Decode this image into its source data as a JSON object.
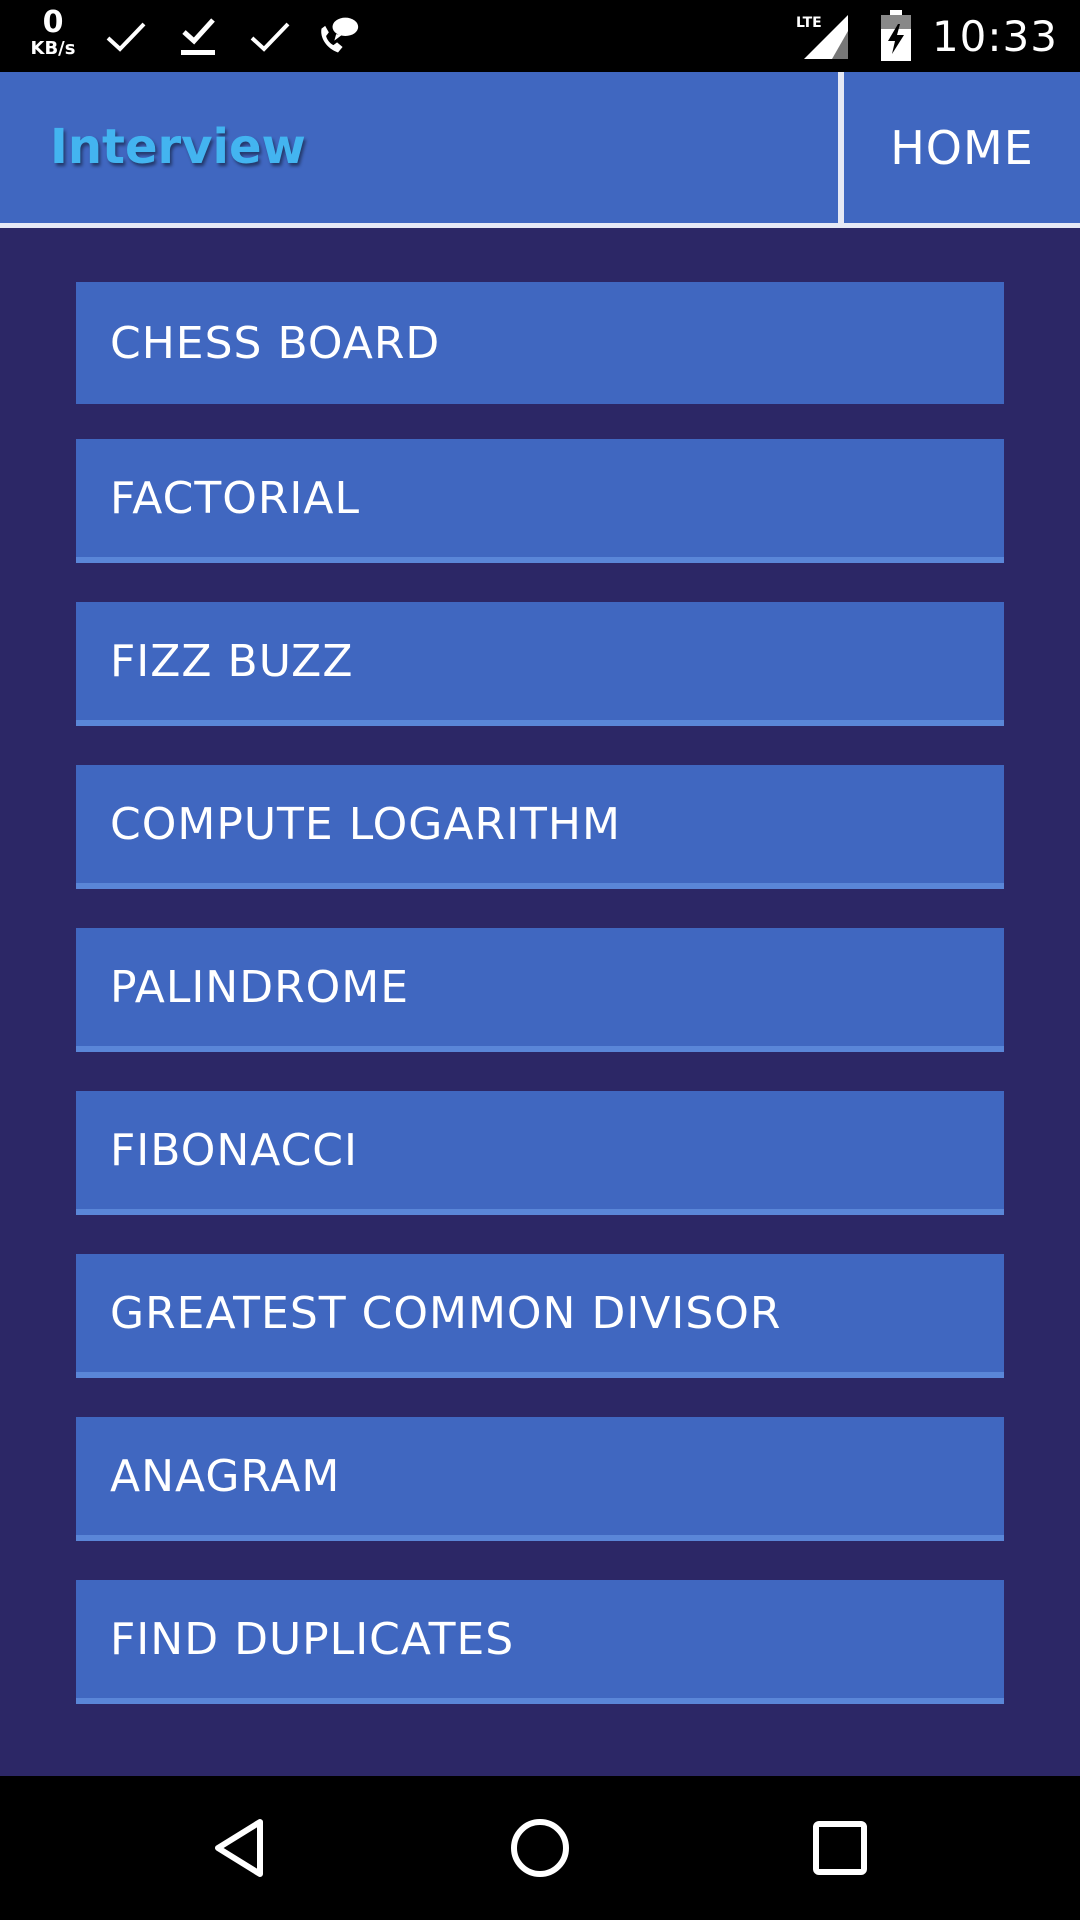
{
  "status_bar": {
    "net_speed_value": "0",
    "net_speed_unit": "KB/s",
    "network": "LTE",
    "clock": "10:33",
    "icons": [
      "check-icon",
      "download-done-icon",
      "check-icon",
      "missed-call-icon",
      "lte-signal-icon",
      "battery-charging-icon"
    ]
  },
  "app_bar": {
    "title": "Interview",
    "home_label": "HOME",
    "title_color": "#43b4f0",
    "bar_color": "#4067c0"
  },
  "menu": {
    "items": [
      {
        "label": "CHESS BOARD"
      },
      {
        "label": "FACTORIAL"
      },
      {
        "label": "FIZZ BUZZ"
      },
      {
        "label": "COMPUTE LOGARITHM"
      },
      {
        "label": "PALINDROME"
      },
      {
        "label": "FIBONACCI"
      },
      {
        "label": "GREATEST COMMON DIVISOR"
      },
      {
        "label": "ANAGRAM"
      },
      {
        "label": "FIND DUPLICATES"
      }
    ]
  },
  "nav_bar": {
    "icons": [
      "back-icon",
      "home-icon",
      "recents-icon"
    ]
  },
  "colors": {
    "background": "#2c2766",
    "button": "#4067c0",
    "button_underline": "#5a86d8"
  }
}
